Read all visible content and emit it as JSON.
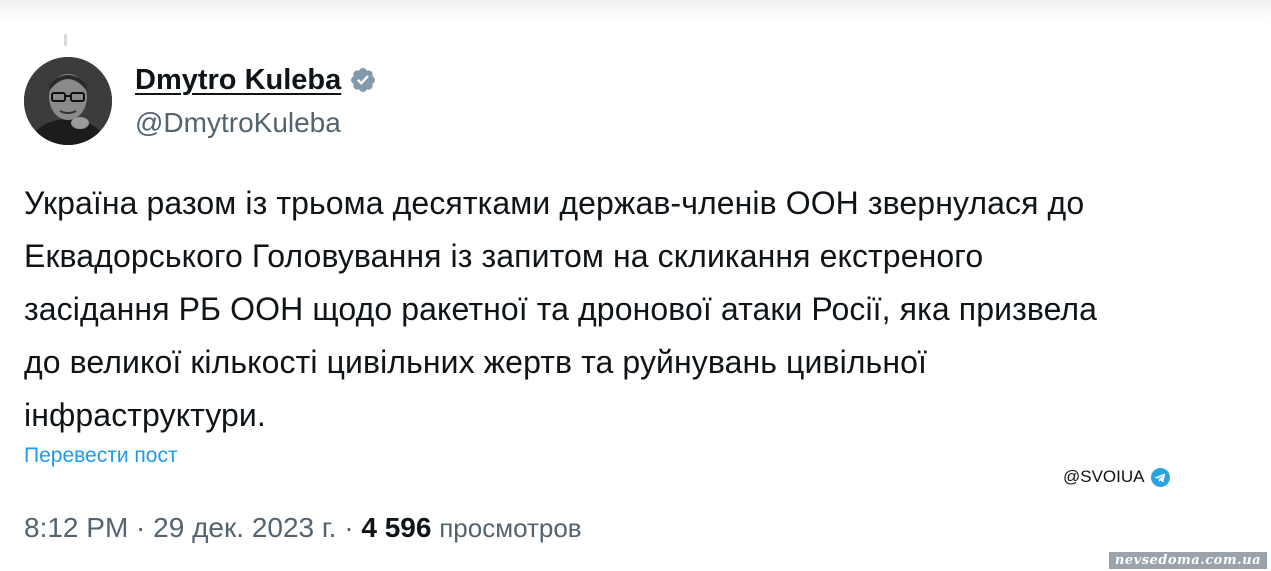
{
  "tweet": {
    "author": {
      "display_name": "Dmytro Kuleba",
      "handle": "@DmytroKuleba",
      "verified": true,
      "verified_icon": "verified-badge-icon"
    },
    "text": "Україна разом із трьома десятками держав-членів ООН звернулася до\nЕквадорського Головування із запитом на скликання екстреного\nзасідання РБ ООН щодо ракетної та дронової атаки Росії, яка призвела\nдо великої кількості цивільних жертв та руйнувань цивільної\nінфраструктури.",
    "translate_link": "Перевести пост",
    "time": "8:12 PM",
    "separator": " · ",
    "date": "29 дек. 2023 г.",
    "views_count": "4 596",
    "views_label": "просмотров"
  },
  "overlay": {
    "channel_tag": "@SVOIUA",
    "channel_icon": "telegram-icon",
    "watermark": "nevsedoma.com.ua"
  },
  "colors": {
    "text": "#0f1419",
    "secondary": "#536471",
    "link": "#1d9bf0",
    "verified_badge": "#829aab"
  }
}
